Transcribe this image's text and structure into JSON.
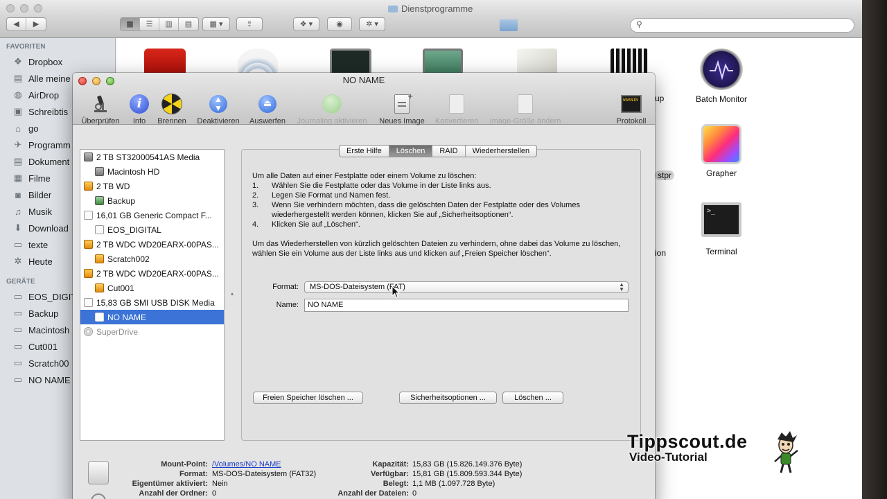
{
  "finder": {
    "title": "Dienstprogramme",
    "sidebar": {
      "favorites_header": "FAVORITEN",
      "favorites": [
        {
          "label": "Dropbox",
          "icon": "dropbox-icon"
        },
        {
          "label": "Alle meine",
          "icon": "all-files-icon"
        },
        {
          "label": "AirDrop",
          "icon": "airdrop-icon"
        },
        {
          "label": "Schreibtis",
          "icon": "desktop-icon"
        },
        {
          "label": "go",
          "icon": "home-icon"
        },
        {
          "label": "Programm",
          "icon": "applications-icon"
        },
        {
          "label": "Dokument",
          "icon": "documents-icon"
        },
        {
          "label": "Filme",
          "icon": "movies-icon"
        },
        {
          "label": "Bilder",
          "icon": "pictures-icon"
        },
        {
          "label": "Musik",
          "icon": "music-icon"
        },
        {
          "label": "Download",
          "icon": "downloads-icon"
        },
        {
          "label": "texte",
          "icon": "folder-icon"
        },
        {
          "label": "Heute",
          "icon": "gear-icon"
        }
      ],
      "devices_header": "GERÄTE",
      "devices": [
        {
          "label": "EOS_DIGIT",
          "icon": "drive-icon"
        },
        {
          "label": "Backup",
          "icon": "drive-icon"
        },
        {
          "label": "Macintosh",
          "icon": "drive-icon"
        },
        {
          "label": "Cut001",
          "icon": "drive-icon"
        },
        {
          "label": "Scratch00",
          "icon": "drive-icon"
        },
        {
          "label": "NO NAME",
          "icon": "drive-icon"
        }
      ]
    },
    "apps": {
      "batch_monitor": "Batch Monitor",
      "grapher": "Grapher",
      "terminal": "Terminal",
      "partial_up": "up",
      "partial_stpr": "stpr",
      "partial_ion": "ion"
    }
  },
  "disk_utility": {
    "title": "NO NAME",
    "toolbar": [
      {
        "label": "Überprüfen",
        "icon": "microscope-icon",
        "enabled": true
      },
      {
        "label": "Info",
        "icon": "info-icon",
        "enabled": true
      },
      {
        "label": "Brennen",
        "icon": "burn-icon",
        "enabled": true
      },
      {
        "label": "Deaktivieren",
        "icon": "unmount-icon",
        "enabled": true
      },
      {
        "label": "Auswerfen",
        "icon": "eject-icon",
        "enabled": true
      },
      {
        "label": "Journaling aktivieren",
        "icon": "journaling-icon",
        "enabled": false
      },
      {
        "label": "Neues Image",
        "icon": "new-image-icon",
        "enabled": true
      },
      {
        "label": "Konvertieren",
        "icon": "convert-icon",
        "enabled": false
      },
      {
        "label": "Image-Größe ändern",
        "icon": "resize-image-icon",
        "enabled": false
      },
      {
        "label": "Protokoll",
        "icon": "log-icon",
        "enabled": true
      }
    ],
    "log_icon_text": "WARNIN AY 7:36",
    "disks": [
      {
        "label": "2 TB ST32000541AS Media",
        "level": 0,
        "type": "internal"
      },
      {
        "label": "Macintosh HD",
        "level": 1,
        "type": "internal"
      },
      {
        "label": "2 TB WD",
        "level": 0,
        "type": "external"
      },
      {
        "label": "Backup",
        "level": 1,
        "type": "timemachine"
      },
      {
        "label": "16,01 GB Generic Compact F...",
        "level": 0,
        "type": "card"
      },
      {
        "label": "EOS_DIGITAL",
        "level": 1,
        "type": "card"
      },
      {
        "label": "2 TB WDC WD20EARX-00PAS...",
        "level": 0,
        "type": "external"
      },
      {
        "label": "Scratch002",
        "level": 1,
        "type": "external"
      },
      {
        "label": "2 TB WDC WD20EARX-00PAS...",
        "level": 0,
        "type": "external"
      },
      {
        "label": "Cut001",
        "level": 1,
        "type": "external"
      },
      {
        "label": "15,83 GB SMI USB DISK Media",
        "level": 0,
        "type": "usb"
      },
      {
        "label": "NO NAME",
        "level": 1,
        "type": "usb",
        "selected": true
      },
      {
        "label": "SuperDrive",
        "level": 0,
        "type": "optical",
        "dimmed": true
      }
    ],
    "tabs": [
      "Erste Hilfe",
      "Löschen",
      "RAID",
      "Wiederherstellen"
    ],
    "active_tab": "Löschen",
    "instructions": {
      "intro": "Um alle Daten auf einer Festplatte oder einem Volume zu löschen:",
      "steps": [
        {
          "n": "1.",
          "text": "Wählen Sie die Festplatte oder das Volume in der Liste links aus."
        },
        {
          "n": "2.",
          "text": "Legen Sie Format und Namen fest."
        },
        {
          "n": "3.",
          "text": "Wenn Sie verhindern möchten, dass die gelöschten Daten der Festplatte oder des Volumes wiederhergestellt werden können, klicken Sie auf „Sicherheitsoptionen“."
        },
        {
          "n": "4.",
          "text": "Klicken Sie auf „Löschen“."
        }
      ],
      "restore_note": "Um das Wiederherstellen von kürzlich gelöschten Dateien zu verhindern, ohne dabei das Volume zu löschen, wählen Sie ein Volume aus der Liste links aus und klicken auf „Freien Speicher löschen“."
    },
    "format_label": "Format:",
    "format_value": "MS-DOS-Dateisystem (FAT)",
    "name_label": "Name:",
    "name_value": "NO NAME",
    "buttons": {
      "free_space": "Freien Speicher löschen ...",
      "security": "Sicherheitsoptionen ...",
      "erase": "Löschen ..."
    },
    "info": {
      "mount_point_label": "Mount-Point:",
      "mount_point": "/Volumes/NO NAME",
      "format_label": "Format:",
      "format": "MS-DOS-Dateisystem (FAT32)",
      "owners_label": "Eigentümer aktiviert:",
      "owners": "Nein",
      "folders_label": "Anzahl der Ordner:",
      "folders": "0",
      "capacity_label": "Kapazität:",
      "capacity": "15,83 GB (15.826.149.376 Byte)",
      "available_label": "Verfügbar:",
      "available": "15,81 GB (15.809.593.344 Byte)",
      "used_label": "Belegt:",
      "used": "1,1 MB (1.097.728 Byte)",
      "files_label": "Anzahl der Dateien:",
      "files": "0"
    }
  },
  "watermark": {
    "site": "Tippscout.de",
    "subtitle": "Video-Tutorial"
  },
  "colors": {
    "selection": "#3b73d6",
    "sidebar_bg": "#dde1e6",
    "link": "#1a3ec8"
  }
}
